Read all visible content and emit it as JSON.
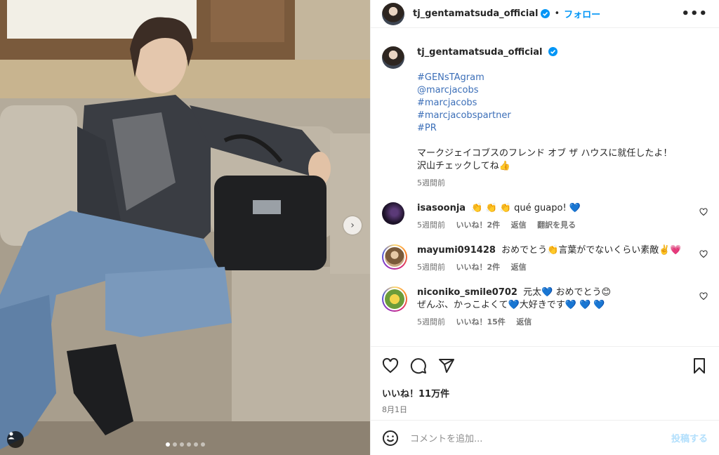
{
  "header": {
    "username": "tj_gentamatsuda_official",
    "separator": "•",
    "follow_label": "フォロー",
    "more_label": "•••"
  },
  "caption": {
    "username": "tj_gentamatsuda_official",
    "hashtags": [
      "#GENsTAgram",
      "@marcjacobs",
      "#marcjacobs",
      "#marcjacobspartner",
      "#PR"
    ],
    "text_line1": "マークジェイコブスのフレンド オブ ザ ハウスに就任したよ！",
    "text_line2": "沢山チェックしてね👍",
    "time": "5週間前"
  },
  "comments": [
    {
      "username": "isasoonja",
      "text": "👏 👏 👏 qué guapo! 💙",
      "time": "5週間前",
      "likes": "いいね！2件",
      "reply": "返信",
      "translate": "翻訳を見る"
    },
    {
      "username": "mayumi091428",
      "text": "おめでとう👏言葉がでないくらい素敵✌️💗",
      "time": "5週間前",
      "likes": "いいね！2件",
      "reply": "返信"
    },
    {
      "username": "niconiko_smile0702",
      "text_line1": "元太💙 おめでとう😊",
      "text_line2": "ぜんぶ、かっこよくて💙大好きです💙 💙 💙",
      "time": "5週間前",
      "likes": "いいね！15件",
      "reply": "返信"
    }
  ],
  "post": {
    "likes": "いいね！11万件",
    "date": "8月1日"
  },
  "add_comment": {
    "placeholder": "コメントを追加...",
    "post_label": "投稿する"
  },
  "carousel": {
    "total": 6,
    "current": 1
  },
  "colors": {
    "link_blue": "#0095f6",
    "hashtag": "#3c6fb8",
    "verified": "#0095f6"
  }
}
